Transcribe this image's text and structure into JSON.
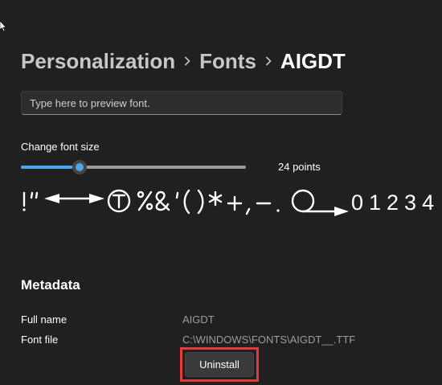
{
  "breadcrumb": {
    "items": [
      "Personalization",
      "Fonts"
    ],
    "current": "AIGDT"
  },
  "preview": {
    "placeholder": "Type here to preview font."
  },
  "font_size": {
    "label": "Change font size",
    "value_label": "24 points",
    "slider_fraction": 0.26
  },
  "glyph_preview": {
    "marks": "!\" ↔ Ⓣ % & ' ( ) * + , − . ○→ 0 1 2 3 4",
    "circled_letter": "T",
    "digits": "01234"
  },
  "metadata": {
    "title": "Metadata",
    "full_name_label": "Full name",
    "full_name_value": "AIGDT",
    "font_file_label": "Font file",
    "font_file_value": "C:\\WINDOWS\\FONTS\\AIGDT__.TTF"
  },
  "actions": {
    "uninstall_label": "Uninstall"
  },
  "colors": {
    "background": "#202020",
    "accent": "#4ca6ea",
    "highlight": "#e6393c",
    "muted_text": "#9d9d9d"
  }
}
